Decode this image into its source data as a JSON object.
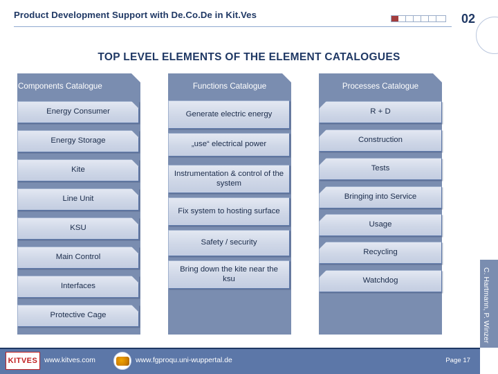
{
  "header": {
    "title": "Product Development Support with De.Co.De in Kit.Ves",
    "page_number": "02",
    "progress_filled_steps": 1,
    "progress_total_steps": 7
  },
  "page_title": "TOP LEVEL ELEMENTS OF THE ELEMENT CATALOGUES",
  "columns": [
    {
      "header": "Components Catalogue",
      "items": [
        "Energy Consumer",
        "Energy Storage",
        "Kite",
        "Line Unit",
        "KSU",
        "Main Control",
        "Interfaces",
        "Protective Cage"
      ]
    },
    {
      "header": "Functions Catalogue",
      "items": [
        "Generate electric energy",
        "„use“ electrical power",
        "Instrumentation & control of the system",
        "Fix system to hosting surface",
        "Safety / security",
        "Bring down the kite near the ksu"
      ]
    },
    {
      "header": "Processes Catalogue",
      "items": [
        "R + D",
        "Construction",
        "Tests",
        "Bringing into Service",
        "Usage",
        "Recycling",
        "Watchdog"
      ]
    }
  ],
  "side_credit": "C. Hartmann, P. Winzer",
  "footer": {
    "logo_text": "KITVES",
    "link_primary": "www.kitves.com",
    "link_secondary": "www.fgproqu.uni-wuppertal.de",
    "page_label": "Page 17"
  },
  "colors": {
    "accent_dark_blue": "#1f3864",
    "column_blue": "#7a8db0",
    "box_fill": "#d3d9e8",
    "footer_band": "#5c77a8",
    "progress_red": "#a33d3d"
  }
}
